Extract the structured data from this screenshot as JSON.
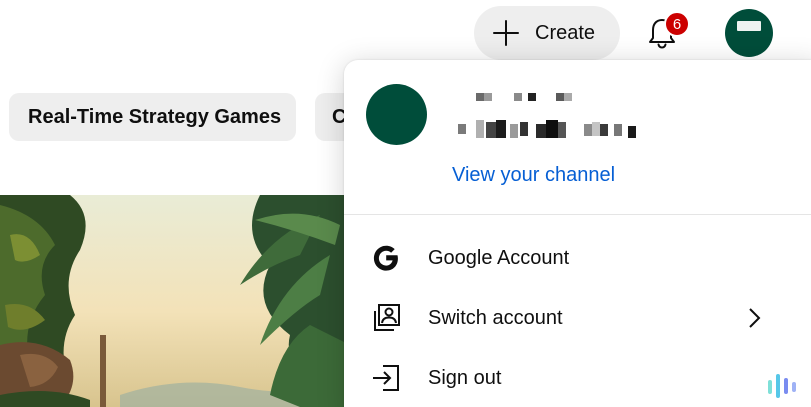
{
  "header": {
    "create_label": "Create",
    "create_icon": "plus-icon",
    "notification_count": "6",
    "notification_icon": "bell-icon",
    "avatar_icon": "account-avatar"
  },
  "chips": [
    "Real-Time Strategy Games",
    "C"
  ],
  "account_menu": {
    "view_channel_label": "View your channel",
    "items": [
      {
        "label": "Google Account",
        "icon": "google-icon"
      },
      {
        "label": "Switch account",
        "icon": "switch-account-icon",
        "has_submenu": true
      },
      {
        "label": "Sign out",
        "icon": "sign-out-icon"
      }
    ]
  },
  "colors": {
    "avatar": "#004d3a",
    "link": "#065fd4",
    "badge": "#cc0000",
    "chip_bg": "#eeeeee"
  }
}
